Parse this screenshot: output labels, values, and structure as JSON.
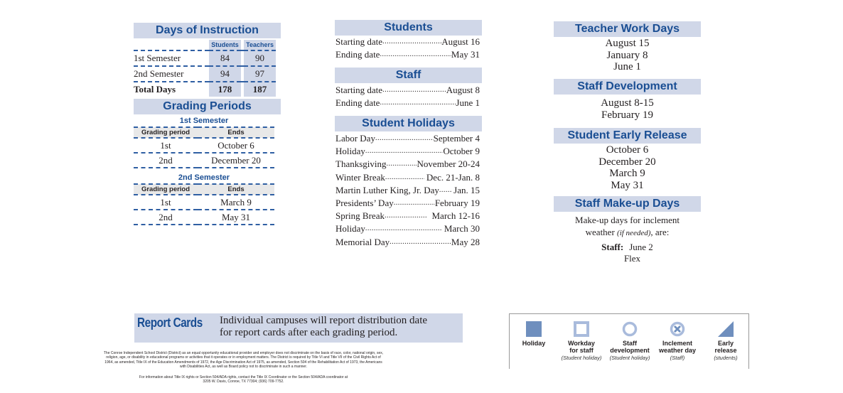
{
  "days_of_instruction": {
    "title": "Days of Instruction",
    "columns": [
      "Students",
      "Teachers"
    ],
    "rows": [
      {
        "label": "1st Semester",
        "students": "84",
        "teachers": "90"
      },
      {
        "label": "2nd Semester",
        "students": "94",
        "teachers": "97"
      },
      {
        "label": "Total Days",
        "students": "178",
        "teachers": "187"
      }
    ]
  },
  "grading_periods": {
    "title": "Grading Periods",
    "semesters": [
      {
        "title": "1st Semester",
        "headers": [
          "Grading period",
          "Ends"
        ],
        "rows": [
          {
            "period": "1st",
            "ends": "October 6"
          },
          {
            "period": "2nd",
            "ends": "December 20"
          }
        ]
      },
      {
        "title": "2nd Semester",
        "headers": [
          "Grading period",
          "Ends"
        ],
        "rows": [
          {
            "period": "1st",
            "ends": "March 9"
          },
          {
            "period": "2nd",
            "ends": "May 31"
          }
        ]
      }
    ]
  },
  "students": {
    "title": "Students",
    "items": [
      {
        "label": "Starting date",
        "value": "August 16"
      },
      {
        "label": "Ending date",
        "value": "May 31"
      }
    ]
  },
  "staff": {
    "title": "Staff",
    "items": [
      {
        "label": "Starting date",
        "value": "August 8"
      },
      {
        "label": "Ending date",
        "value": "June 1"
      }
    ]
  },
  "student_holidays": {
    "title": "Student Holidays",
    "items": [
      {
        "label": "Labor Day",
        "value": "September 4"
      },
      {
        "label": "Holiday",
        "value": "October 9"
      },
      {
        "label": "Thanksgiving ",
        "value": "November 20-24"
      },
      {
        "label": "Winter Break",
        "value": " Dec. 21-Jan. 8"
      },
      {
        "label": "Martin Luther King, Jr. Day",
        "value": " Jan. 15"
      },
      {
        "label": "Presidents’ Day",
        "value": "February 19"
      },
      {
        "label": "Spring Break",
        "value": "  March 12-16"
      },
      {
        "label": "Holiday",
        "value": " March 30"
      },
      {
        "label": "Memorial Day",
        "value": "May 28"
      }
    ]
  },
  "teacher_work_days": {
    "title": "Teacher Work Days",
    "dates": [
      "August 15",
      "January 8",
      "June 1"
    ]
  },
  "staff_development": {
    "title": "Staff Development",
    "dates": [
      "August 8-15",
      "February 19"
    ]
  },
  "student_early_release": {
    "title": "Student Early Release",
    "dates": [
      "October 6",
      "December 20",
      "March 9",
      "May 31"
    ]
  },
  "staff_makeup_days": {
    "title": "Staff Make-up Days",
    "line1": "Make-up days for inclement",
    "line2_pre": "weather ",
    "line2_italic": "(if needed)",
    "line2_post": ", are:",
    "staff_label": "Staff:",
    "staff_value": "June 2",
    "extra": "Flex"
  },
  "report_cards": {
    "label": "Report Cards",
    "line1": "Individual campuses will report distribution date",
    "line2": "for report cards after each grading period."
  },
  "legal": {
    "notice": "The Conroe Independent School District (District) as an equal opportunity educational provider and employer does not discriminate on the basis of race, color, national origin, sex, religion, age, or disability in educational programs or activities that it operates or in employment matters. The District is required by Title VI and Title VII of the Civil Rights Act of 1964, as amended, Title IX of the Education Amendments of 1972, the Age Discrimination Act of 1975, as amended, Section 504 of the Rehabilitation Act of 1973, the Americans with Disabilities Act, as well as Board policy not to discriminate in such a manner.",
    "contact_line1": "For information about Title IX rights or Section 504/ADA rights, contact the Title IX Coordinator or the Section 504/ADA coordinator at",
    "contact_line2": "3205 W. Davis, Conroe, TX 77304; (936) 709-7752."
  },
  "legend": {
    "colors": {
      "fill": "#6f8fbe",
      "light": "#a9bbdc"
    },
    "items": [
      {
        "icon": "filled-square-icon",
        "label1": "Holiday",
        "label2": "",
        "sub": ""
      },
      {
        "icon": "outline-square-icon",
        "label1": "Workday",
        "label2": "for staff",
        "sub": "(Student holiday)"
      },
      {
        "icon": "outline-circle-icon",
        "label1": "Staff",
        "label2": "development",
        "sub": "(Student holiday)"
      },
      {
        "icon": "circle-x-icon",
        "label1": "Inclement",
        "label2": "weather day",
        "sub": "(Staff)"
      },
      {
        "icon": "triangle-icon",
        "label1": "Early",
        "label2": "release",
        "sub": "(students)"
      }
    ]
  }
}
